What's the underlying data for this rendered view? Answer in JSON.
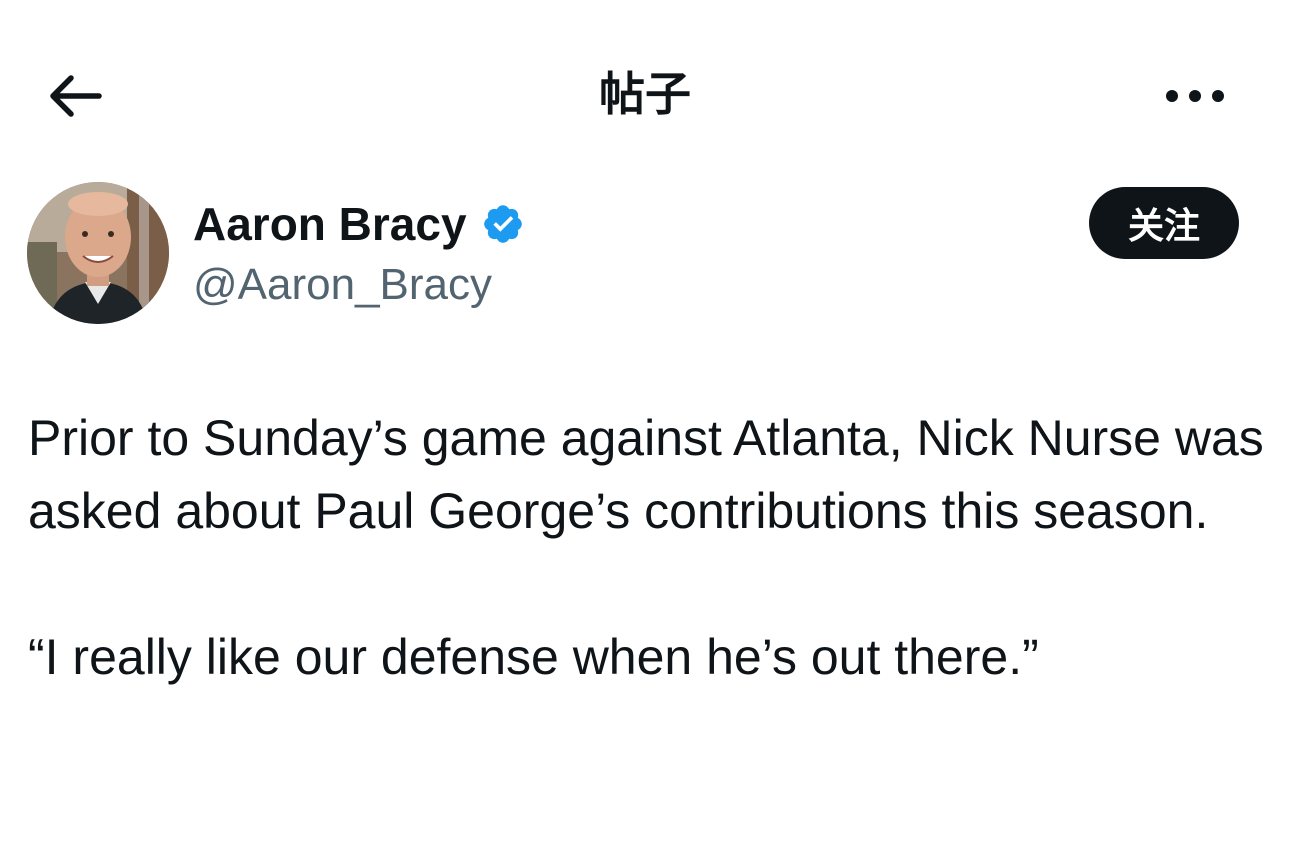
{
  "header": {
    "title": "帖子",
    "back_icon": "arrow-left-icon",
    "more_icon": "more-horizontal-icon"
  },
  "author": {
    "name": "Aaron Bracy",
    "handle": "@Aaron_Bracy",
    "verified": true,
    "verified_color": "#1d9bf0"
  },
  "follow_button": {
    "label": "关注"
  },
  "post": {
    "paragraphs": [
      "Prior to Sunday’s game against Atlanta, Nick Nurse was asked about Paul George’s contributions this season.",
      "“I really like our defense when he’s out there.”"
    ]
  }
}
